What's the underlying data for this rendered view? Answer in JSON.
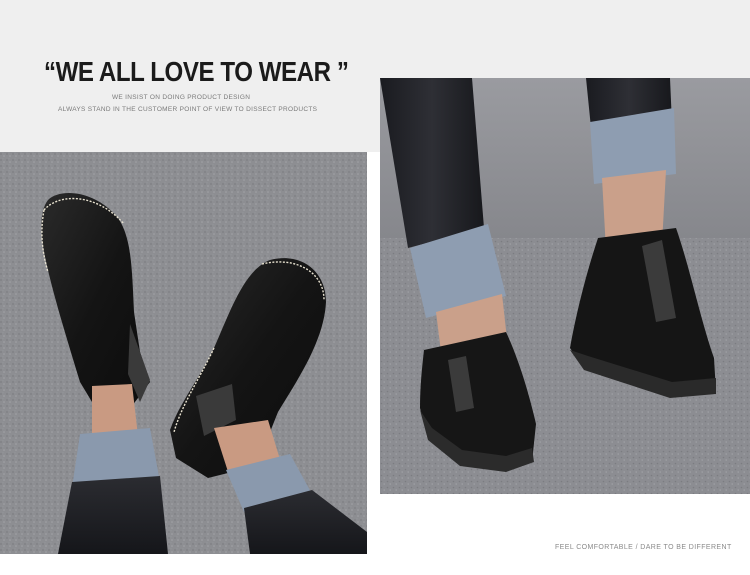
{
  "header": {
    "title": "“WE ALL LOVE TO WEAR ”",
    "subtitle_line1": "WE INSIST ON DOING PRODUCT DESIGN",
    "subtitle_line2": "ALWAYS STAND IN THE CUSTOMER POINT OF VIEW TO DISSECT PRODUCTS"
  },
  "photos": {
    "left": {
      "subject": "feet wearing black leather chelsea boots on grey carpet"
    },
    "right": {
      "subject": "person walking in black chelsea boots and cuffed dark jeans"
    }
  },
  "footer": {
    "tagline": "FEEL COMFORTABLE / DARE TO BE DIFFERENT"
  },
  "colors": {
    "band": "#efefef",
    "carpet": "#8e8f93",
    "boot": "#1a1a1a",
    "denim": "#1e1f24"
  }
}
